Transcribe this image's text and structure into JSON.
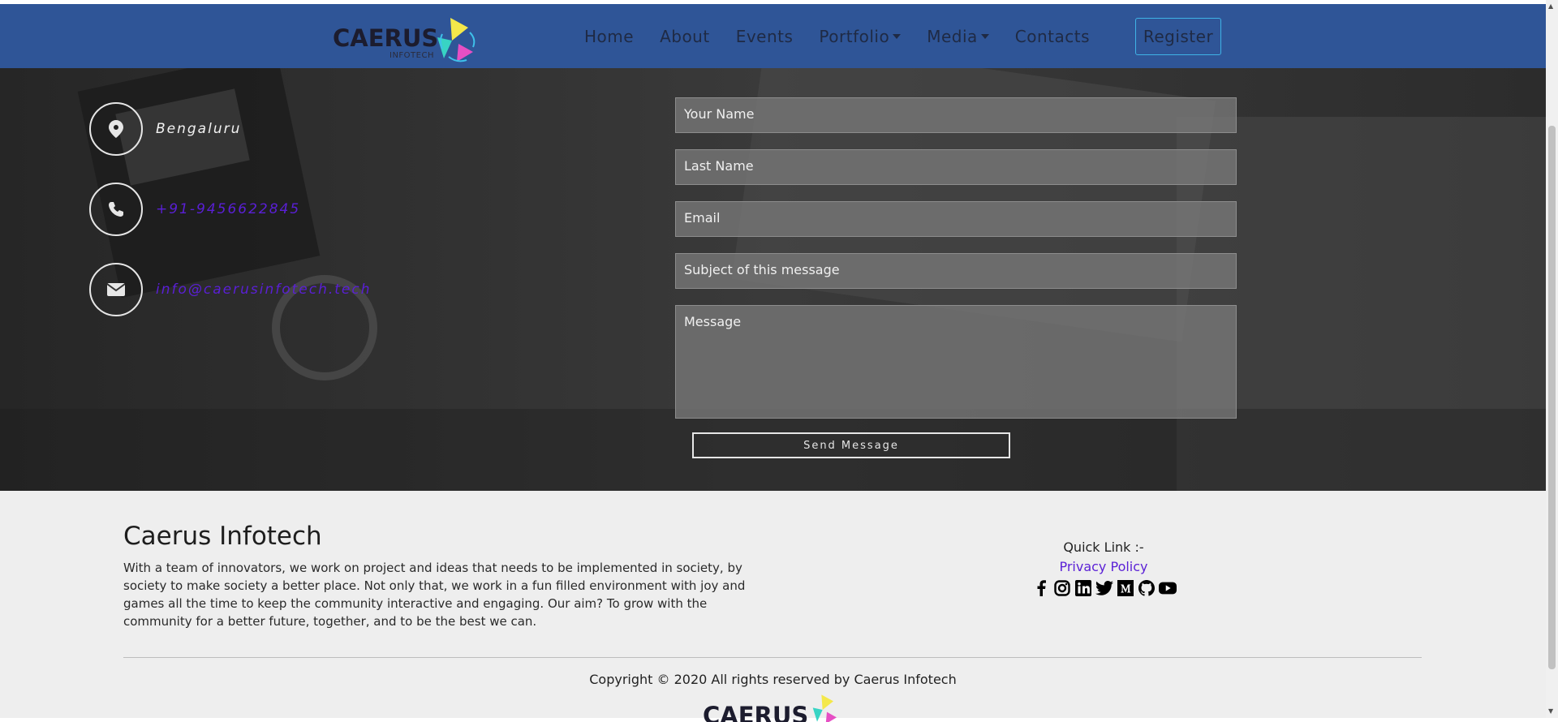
{
  "brand": {
    "name": "CAERUS",
    "sub": "INFOTECH"
  },
  "nav": {
    "items": [
      "Home",
      "About",
      "Events",
      "Portfolio",
      "Media",
      "Contacts"
    ],
    "register": "Register"
  },
  "contact_info": {
    "location": "Bengaluru",
    "phone": "+91-9456622845",
    "email": "info@caerusinfotech.tech"
  },
  "form": {
    "first_name_placeholder": "Your Name",
    "last_name_placeholder": "Last Name",
    "email_placeholder": "Email",
    "subject_placeholder": "Subject of this message",
    "message_placeholder": "Message",
    "send_label": "Send Message"
  },
  "footer": {
    "title": "Caerus Infotech",
    "description": "With a team of innovators, we work on project and ideas that needs to be implemented in society, by society to make society a better place. Not only that, we work in a fun filled environment with joy and games all the time to keep the community interactive and engaging. Our aim? To grow with the community for a better future, together, and to be the best we can.",
    "quick_link_label": "Quick Link :-",
    "privacy_label": "Privacy Policy",
    "socials": [
      "facebook-icon",
      "instagram-icon",
      "linkedin-icon",
      "twitter-icon",
      "medium-icon",
      "github-icon",
      "youtube-icon"
    ],
    "copyright": "Copyright © 2020 All rights reserved by Caerus Infotech"
  },
  "colors": {
    "navbar": "#2f5597",
    "link_purple": "#5a1fd6",
    "register_border": "#3fb3e6",
    "footer_bg": "#eeeeee"
  }
}
